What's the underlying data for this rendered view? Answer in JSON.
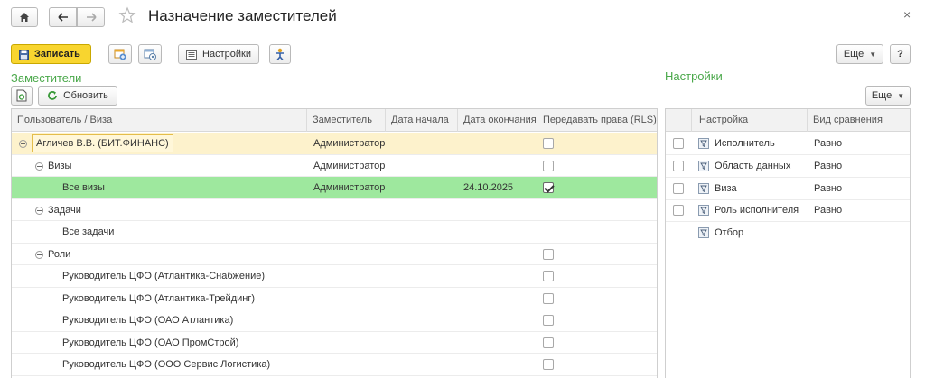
{
  "window": {
    "title": "Назначение заместителей",
    "close_symbol": "×"
  },
  "toolbar": {
    "save_label": "Записать",
    "settings_label": "Настройки",
    "more_label": "Еще",
    "help_label": "?"
  },
  "left_section": {
    "title": "Заместители",
    "refresh_label": "Обновить",
    "columns": [
      "Пользователь / Виза",
      "Заместитель",
      "Дата начала",
      "Дата окончания",
      "Передавать права (RLS)"
    ],
    "rows": [
      {
        "name": "Агличев В.В. (БИТ.ФИНАНС)",
        "deputy": "Администратор",
        "start": "",
        "end": "",
        "rls": false
      },
      {
        "name": "Визы",
        "deputy": "Администратор",
        "start": "",
        "end": "",
        "rls": false
      },
      {
        "name": "Все визы",
        "deputy": "Администратор",
        "start": "",
        "end": "24.10.2025",
        "rls": true
      },
      {
        "name": "Задачи",
        "deputy": "",
        "start": "",
        "end": "",
        "rls": null
      },
      {
        "name": "Все задачи",
        "deputy": "",
        "start": "",
        "end": "",
        "rls": null
      },
      {
        "name": "Роли",
        "deputy": "",
        "start": "",
        "end": "",
        "rls": false
      },
      {
        "name": "Руководитель ЦФО (Атлантика-Снабжение)",
        "deputy": "",
        "start": "",
        "end": "",
        "rls": false
      },
      {
        "name": "Руководитель ЦФО (Атлантика-Трейдинг)",
        "deputy": "",
        "start": "",
        "end": "",
        "rls": false
      },
      {
        "name": "Руководитель ЦФО (ОАО Атлантика)",
        "deputy": "",
        "start": "",
        "end": "",
        "rls": false
      },
      {
        "name": "Руководитель ЦФО (ОАО ПромСтрой)",
        "deputy": "",
        "start": "",
        "end": "",
        "rls": false
      },
      {
        "name": "Руководитель ЦФО (ООО Сервис Логистика)",
        "deputy": "",
        "start": "",
        "end": "",
        "rls": false
      }
    ]
  },
  "right_section": {
    "title": "Настройки",
    "more_label": "Еще",
    "columns": [
      "Настройка",
      "Вид сравнения"
    ],
    "rows": [
      {
        "setting": "Исполнитель",
        "comparison": "Равно",
        "checked": false
      },
      {
        "setting": "Область данных",
        "comparison": "Равно",
        "checked": false
      },
      {
        "setting": "Виза",
        "comparison": "Равно",
        "checked": false
      },
      {
        "setting": "Роль исполнителя",
        "comparison": "Равно",
        "checked": false
      },
      {
        "setting": "Отбор",
        "comparison": "",
        "checked": null
      }
    ]
  },
  "colors": {
    "accent_green": "#4aa84a",
    "save_yellow": "#f8d52f",
    "selected_row": "#9ee89e",
    "current_row": "#fdf2cc"
  },
  "icons": [
    "home-icon",
    "arrow-left-icon",
    "arrow-right-icon",
    "star-icon",
    "close-icon",
    "save-icon",
    "calendar-add-icon",
    "calendar-settings-icon",
    "settings-list-icon",
    "person-icon",
    "refresh-icon",
    "filter-icon"
  ]
}
